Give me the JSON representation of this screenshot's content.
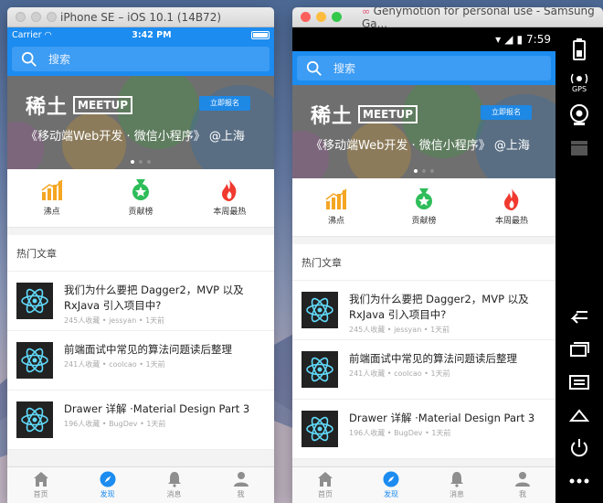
{
  "ios_window": {
    "title": "iPhone SE – iOS 10.1 (14B72)",
    "status": {
      "carrier": "Carrier",
      "time": "3:42 PM"
    }
  },
  "genymotion_window": {
    "title": "Genymotion for personal use - Samsung Ga...",
    "status": {
      "time": "7:59"
    },
    "side_buttons": {
      "gps": "GPS"
    }
  },
  "app": {
    "search": {
      "placeholder": "搜索"
    },
    "banner": {
      "brand": "稀土",
      "brand_tag": "MEETUP",
      "register_button": "立即报名",
      "subtitle": "《移动端Web开发 · 微信小程序》 @上海"
    },
    "shortcuts": [
      {
        "label": "沸点",
        "icon": "bar-chart-icon",
        "color": "#f5a623"
      },
      {
        "label": "贡献榜",
        "icon": "medal-icon",
        "color": "#2ebd59"
      },
      {
        "label": "本周最热",
        "icon": "fire-icon",
        "color": "#f03a2f"
      }
    ],
    "section_title": "热门文章",
    "articles": [
      {
        "title": "我们为什么要把 Dagger2，MVP 以及 RxJava 引入项目中?",
        "meta": "245人收藏 • jessyan • 1天前"
      },
      {
        "title": "前端面试中常见的算法问题读后整理",
        "meta": "241人收藏 • coolcao • 1天前"
      },
      {
        "title": "Drawer 详解 ·Material Design Part 3",
        "meta": "196人收藏 • BugDev • 1天前"
      }
    ],
    "tabs": [
      {
        "label": "首页",
        "icon": "home-icon",
        "active": false
      },
      {
        "label": "发现",
        "icon": "compass-icon",
        "active": true
      },
      {
        "label": "消息",
        "icon": "bell-icon",
        "active": false
      },
      {
        "label": "我",
        "icon": "user-icon",
        "active": false
      }
    ]
  },
  "colors": {
    "primary": "#1c8cf0",
    "traffic_red": "#fc605c",
    "traffic_yellow": "#fdbc40",
    "traffic_green": "#34c84a"
  }
}
